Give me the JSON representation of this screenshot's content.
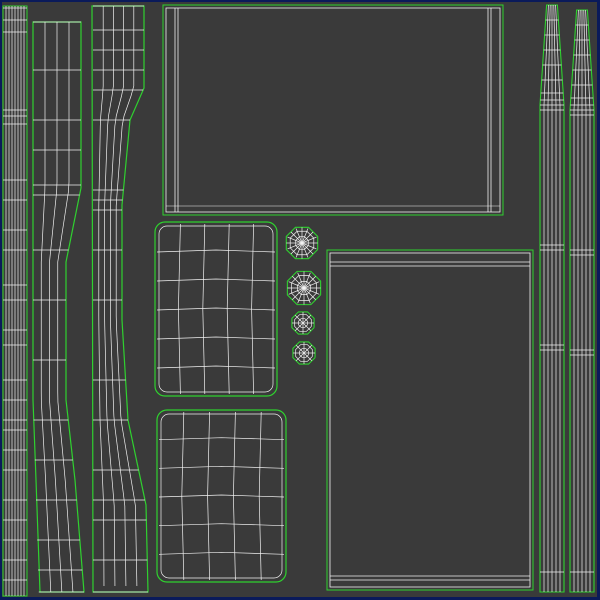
{
  "viewport": {
    "name": "uv-layout-viewport",
    "colors": {
      "frame": "#0a1a5a",
      "background": "#3a3a3a",
      "mesh_edge": "#f2f2f2",
      "seam_edge": "#2fd12f"
    }
  },
  "islands": [
    {
      "name": "uv-island-long-strip"
    },
    {
      "name": "uv-island-curved-panel-left"
    },
    {
      "name": "uv-island-curved-panel-right"
    },
    {
      "name": "uv-island-top-panel"
    },
    {
      "name": "uv-island-cushion-upper"
    },
    {
      "name": "uv-island-cushion-lower"
    },
    {
      "name": "uv-island-cap-large-1"
    },
    {
      "name": "uv-island-cap-large-2"
    },
    {
      "name": "uv-island-cap-small-1"
    },
    {
      "name": "uv-island-cap-small-2"
    },
    {
      "name": "uv-island-side-panel"
    },
    {
      "name": "uv-island-leg-left"
    },
    {
      "name": "uv-island-leg-right"
    }
  ]
}
